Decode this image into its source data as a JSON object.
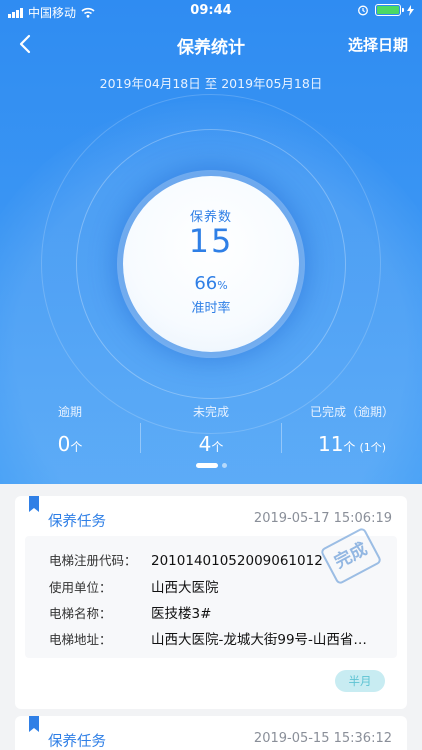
{
  "status_bar": {
    "carrier": "中国移动",
    "time": "09:44"
  },
  "nav": {
    "title": "保养统计",
    "pick_date_label": "选择日期"
  },
  "date_range": "2019年04月18日 至 2019年05月18日",
  "summary": {
    "count_label": "保养数",
    "count_value": "15",
    "ontime_value": "66",
    "ontime_unit": "%",
    "ontime_label": "准时率"
  },
  "stats": [
    {
      "label": "逾期",
      "value": "0",
      "unit": "个",
      "extra": ""
    },
    {
      "label": "未完成",
      "value": "4",
      "unit": "个",
      "extra": ""
    },
    {
      "label": "已完成（逾期）",
      "value": "11",
      "unit": "个",
      "extra": "(1个)"
    }
  ],
  "tasks": [
    {
      "title": "保养任务",
      "time": "2019-05-17 15:06:19",
      "fields": [
        {
          "key": "电梯注册代码：",
          "value": "20101401052009061012"
        },
        {
          "key": "使用单位：",
          "value": "山西大医院"
        },
        {
          "key": "电梯名称：",
          "value": "医技楼3#"
        },
        {
          "key": "电梯地址：",
          "value": "山西大医院-龙城大街99号-山西省…"
        }
      ],
      "stamp": "完成",
      "badge": "半月"
    },
    {
      "title": "保养任务",
      "time": "2019-05-15 15:36:12"
    }
  ],
  "colors": {
    "primary": "#2f7fe6",
    "hero": "#3a95f3",
    "badge_bg": "#c8ecf2"
  }
}
